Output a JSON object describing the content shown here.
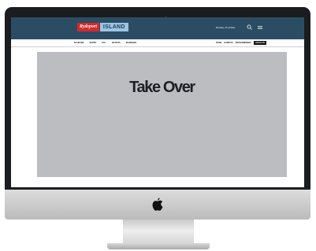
{
  "site": {
    "logo_primary": "Rydsport",
    "logo_secondary": "ISLAND",
    "date": "Monday, 15 october"
  },
  "nav": {
    "left_items": [
      "NYHETER",
      "SPORT",
      "KUL",
      "ARTISTS",
      "MARKNAD"
    ],
    "right_items": [
      "RUNE",
      "KAMPUS",
      "PRENUMERERA"
    ],
    "cta_label": "LOGGA IN"
  },
  "banner": {
    "title": "Take Over"
  },
  "icons": {
    "search": "search-icon",
    "menu": "menu-icon",
    "device": "apple-logo-icon"
  },
  "colors": {
    "header_bg": "#2b4d63",
    "logo_red": "#d42a2a",
    "logo_blue": "#9dc4e3",
    "takeover_bg": "#bcbdc0",
    "bezel": "#1b1c1f"
  }
}
